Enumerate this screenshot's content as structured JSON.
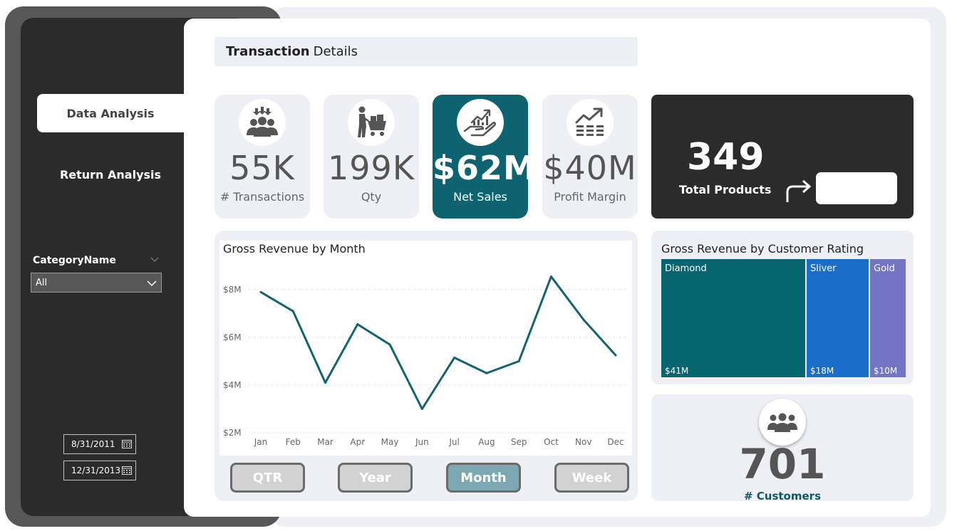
{
  "nav": {
    "active_tab": "Data Analysis",
    "second_tab": "Return Analysis"
  },
  "filters": {
    "category_label": "CategoryName",
    "category_value": "All",
    "start_date": "8/31/2011",
    "end_date": "12/31/2013"
  },
  "header": {
    "title_bold": "Transaction",
    "title_rest": "Details"
  },
  "kpis": [
    {
      "value": "55K",
      "label": "# Transactions",
      "icon": "people-collection-icon"
    },
    {
      "value": "199K",
      "label": "Qty",
      "icon": "shopping-cart-person-icon"
    },
    {
      "value": "$62M",
      "label": "Net Sales",
      "icon": "hand-growth-chart-icon"
    },
    {
      "value": "$40M",
      "label": "Profit Margin",
      "icon": "trend-up-chart-icon"
    }
  ],
  "total_products": {
    "value": "349",
    "label": "Total Products"
  },
  "chart_data": {
    "type": "line",
    "title": "Gross Revenue by Month",
    "categories": [
      "Jan",
      "Feb",
      "Mar",
      "Apr",
      "May",
      "Jun",
      "Jul",
      "Aug",
      "Sep",
      "Oct",
      "Nov",
      "Dec"
    ],
    "values": [
      7.9,
      7.1,
      4.1,
      6.55,
      5.7,
      3.0,
      5.15,
      4.5,
      5.0,
      8.55,
      6.75,
      5.25
    ],
    "y_ticks": [
      "$2M",
      "$4M",
      "$6M",
      "$8M"
    ],
    "ylim": [
      2,
      8.5
    ],
    "color": "#136470"
  },
  "granularity": [
    "QTR",
    "Year",
    "Month",
    "Week"
  ],
  "active_granularity": "Month",
  "treemap": {
    "title": "Gross Revenue by Customer Rating",
    "tiles": [
      {
        "name": "Diamond",
        "value": "$41M",
        "amount": 41,
        "color": "#07656f"
      },
      {
        "name": "Sliver",
        "value": "$18M",
        "amount": 18,
        "color": "#1a6dc8"
      },
      {
        "name": "Gold",
        "value": "$10M",
        "amount": 10,
        "color": "#7274c4"
      }
    ]
  },
  "customers": {
    "value": "701",
    "label": "# Customers"
  }
}
